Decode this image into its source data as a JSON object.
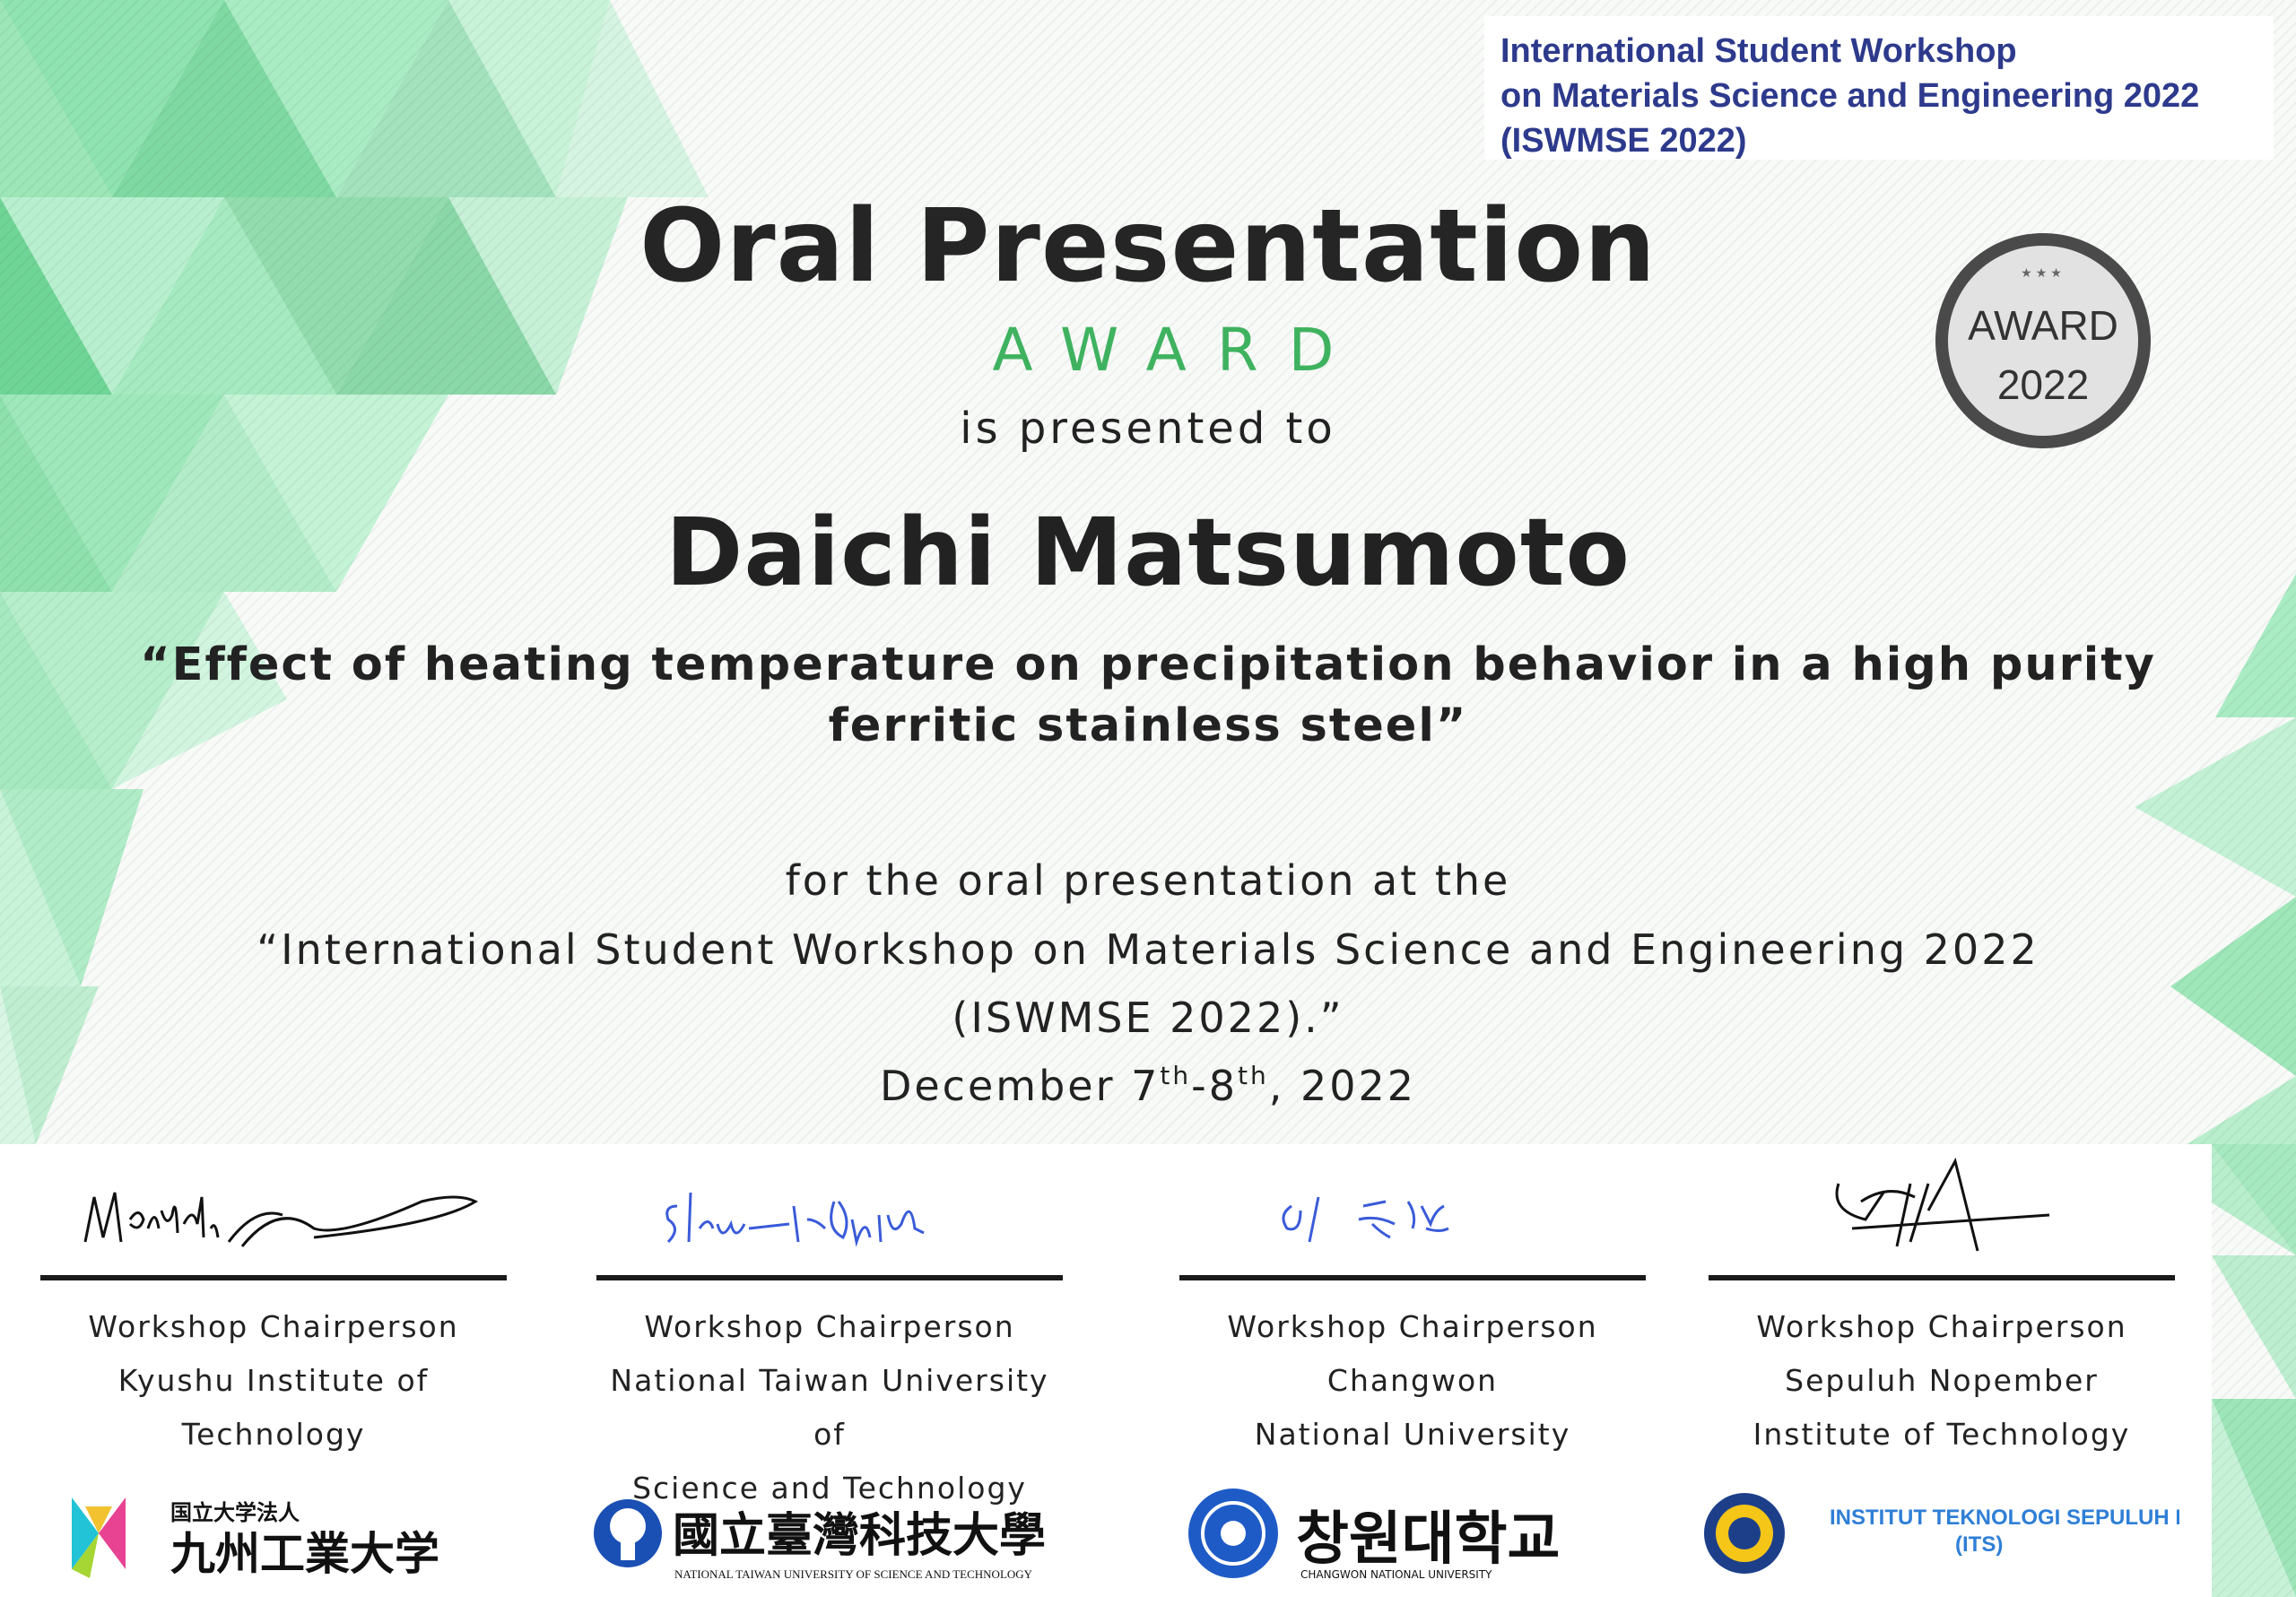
{
  "header": {
    "line1": "International Student Workshop",
    "line2": "on Materials Science and Engineering 2022",
    "line3": "(ISWMSE 2022)"
  },
  "title": "Oral Presentation",
  "award_word": "AWARD",
  "presented_to": "is presented to",
  "recipient": "Daichi Matsumoto",
  "paper_title": {
    "line1": "“Effect of heating temperature on precipitation behavior in a high purity",
    "line2": "ferritic stainless steel”"
  },
  "description": {
    "line1": "for the oral presentation at the",
    "line2": "“International Student Workshop on Materials Science and Engineering 2022",
    "line3": "(ISWMSE 2022).”",
    "date_prefix": "December 7",
    "date_sup1": "th",
    "date_mid": "-8",
    "date_sup2": "th",
    "date_suffix": ", 2022"
  },
  "seal": {
    "line1": "AWARD",
    "line2": "2022"
  },
  "signatories": [
    {
      "role": "Workshop Chairperson",
      "org_line1": "Kyushu Institute of",
      "org_line2": "Technology",
      "logo_small": "国立大学法人",
      "logo_main": "九州工業大学"
    },
    {
      "role": "Workshop Chairperson",
      "org_line1": "National Taiwan University of",
      "org_line2": "Science and Technology",
      "logo_main": "國立臺灣科技大學",
      "logo_sub": "NATIONAL TAIWAN UNIVERSITY OF SCIENCE AND TECHNOLOGY"
    },
    {
      "role": "Workshop Chairperson",
      "org_line1": "Changwon",
      "org_line2": "National University",
      "logo_main": "창원대학교",
      "logo_sub": "CHANGWON NATIONAL UNIVERSITY"
    },
    {
      "role": "Workshop Chairperson",
      "org_line1": "Sepuluh Nopember",
      "org_line2": "Institute of Technology",
      "logo_main": "INSTITUT TEKNOLOGI SEPULUH NOPEMBER",
      "logo_sub": "(ITS)"
    }
  ],
  "colors": {
    "accent_green": "#3fb25f",
    "header_blue": "#2d3a8c",
    "signature_blue": "#3a5bd9",
    "its_blue": "#2f7fd6"
  }
}
